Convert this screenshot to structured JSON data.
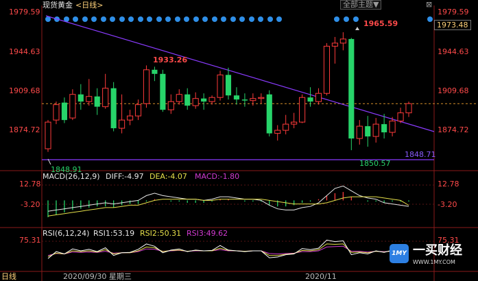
{
  "header": {
    "symbol": "现货黄金",
    "period_selector": "<日线>",
    "all_indicators_button": "全部主题▼",
    "close_button": "⊠"
  },
  "price_axis": {
    "left_ticks": [
      "1979.59",
      "1944.63",
      "1909.68",
      "1874.72"
    ],
    "right_ticks": [
      "1979.59",
      "1944.63",
      "1909.68",
      "1874.72"
    ],
    "current_price": "1973.48"
  },
  "annotations": {
    "high_left": "1933.26",
    "high_right": "1965.59",
    "low_left": "1848.91",
    "low_right": "1850.57",
    "line_price": "1848.71"
  },
  "macd": {
    "title": "MACD(26,12,9)",
    "diff": "DIFF:-4.97",
    "dea": "DEA:-4.07",
    "macd": "MACD:-1.80",
    "ticks_left": [
      "12.78",
      "-3.20"
    ],
    "ticks_right": [
      "12.78",
      "-3.20"
    ]
  },
  "rsi": {
    "title": "RSI(6,12,24)",
    "rsi1": "RSI1:53.19",
    "rsi2": "RSI2:50.31",
    "rsi3": "RSI3:49.62",
    "tick_left": "75.31",
    "tick_right": "75.31"
  },
  "footer": {
    "period": "日线",
    "date": "2020/09/30 星期三",
    "month_label": "2020/11"
  },
  "watermark": {
    "logo_text": "1MY",
    "title": "一买财经",
    "url": "WWW.1MY.COM"
  },
  "colors": {
    "up": "#ff3b3b",
    "down": "#27d46a",
    "trendline": "#8a3bff",
    "macd_diff": "#e8e8e8",
    "macd_dea": "#e6e04a",
    "rsi1": "#ffffff",
    "rsi2": "#e6e04a",
    "rsi3": "#d23bd2",
    "event_dot": "#2f8fe8"
  },
  "chart_data": {
    "type": "candlestick",
    "candles": [
      {
        "o": 1852,
        "h": 1880,
        "c": 1878,
        "l": 1848.91
      },
      {
        "o": 1880,
        "h": 1898,
        "c": 1895,
        "l": 1876
      },
      {
        "o": 1897,
        "h": 1902,
        "c": 1880,
        "l": 1877
      },
      {
        "o": 1882,
        "h": 1910,
        "c": 1905,
        "l": 1880
      },
      {
        "o": 1905,
        "h": 1915,
        "c": 1898,
        "l": 1890
      },
      {
        "o": 1898,
        "h": 1920,
        "c": 1903,
        "l": 1894
      },
      {
        "o": 1903,
        "h": 1911,
        "c": 1893,
        "l": 1885
      },
      {
        "o": 1893,
        "h": 1925,
        "c": 1911,
        "l": 1891
      },
      {
        "o": 1911,
        "h": 1917,
        "c": 1872,
        "l": 1869
      },
      {
        "o": 1872,
        "h": 1905,
        "c": 1880,
        "l": 1867
      },
      {
        "o": 1880,
        "h": 1890,
        "c": 1884,
        "l": 1875
      },
      {
        "o": 1884,
        "h": 1900,
        "c": 1895,
        "l": 1880
      },
      {
        "o": 1896,
        "h": 1933.26,
        "c": 1929,
        "l": 1892
      },
      {
        "o": 1929,
        "h": 1932,
        "c": 1925,
        "l": 1918
      },
      {
        "o": 1925,
        "h": 1929,
        "c": 1890,
        "l": 1888
      },
      {
        "o": 1890,
        "h": 1905,
        "c": 1898,
        "l": 1886
      },
      {
        "o": 1898,
        "h": 1910,
        "c": 1905,
        "l": 1895
      },
      {
        "o": 1905,
        "h": 1911,
        "c": 1894,
        "l": 1890
      },
      {
        "o": 1894,
        "h": 1907,
        "c": 1901,
        "l": 1891
      },
      {
        "o": 1901,
        "h": 1906,
        "c": 1898,
        "l": 1890
      },
      {
        "o": 1898,
        "h": 1904,
        "c": 1902,
        "l": 1895
      },
      {
        "o": 1902,
        "h": 1928,
        "c": 1924,
        "l": 1899
      },
      {
        "o": 1924,
        "h": 1931,
        "c": 1904,
        "l": 1900
      },
      {
        "o": 1904,
        "h": 1912,
        "c": 1900,
        "l": 1895
      },
      {
        "o": 1900,
        "h": 1906,
        "c": 1899,
        "l": 1893
      },
      {
        "o": 1899,
        "h": 1906,
        "c": 1901,
        "l": 1894
      },
      {
        "o": 1901,
        "h": 1906,
        "c": 1902,
        "l": 1896
      },
      {
        "o": 1905,
        "h": 1909,
        "c": 1867,
        "l": 1864
      },
      {
        "o": 1867,
        "h": 1875,
        "c": 1870,
        "l": 1860
      },
      {
        "o": 1870,
        "h": 1885,
        "c": 1876,
        "l": 1866
      },
      {
        "o": 1876,
        "h": 1887,
        "c": 1878,
        "l": 1872
      },
      {
        "o": 1878,
        "h": 1905,
        "c": 1902,
        "l": 1877
      },
      {
        "o": 1902,
        "h": 1912,
        "c": 1898,
        "l": 1893
      },
      {
        "o": 1898,
        "h": 1911,
        "c": 1906,
        "l": 1895
      },
      {
        "o": 1906,
        "h": 1955,
        "c": 1952,
        "l": 1904
      },
      {
        "o": 1952,
        "h": 1961,
        "c": 1955,
        "l": 1935
      },
      {
        "o": 1955,
        "h": 1965.59,
        "c": 1959,
        "l": 1948
      },
      {
        "o": 1959,
        "h": 1960,
        "c": 1862,
        "l": 1850.57
      },
      {
        "o": 1862,
        "h": 1880,
        "c": 1874,
        "l": 1856
      },
      {
        "o": 1874,
        "h": 1884,
        "c": 1864,
        "l": 1854
      },
      {
        "o": 1864,
        "h": 1882,
        "c": 1876,
        "l": 1858
      },
      {
        "o": 1876,
        "h": 1886,
        "c": 1868,
        "l": 1862
      },
      {
        "o": 1868,
        "h": 1883,
        "c": 1879,
        "l": 1864
      },
      {
        "o": 1879,
        "h": 1892,
        "c": 1887,
        "l": 1877
      },
      {
        "o": 1887,
        "h": 1898,
        "c": 1896,
        "l": 1883
      }
    ],
    "ylim": [
      1842,
      1985
    ],
    "macd_hist": [
      -14,
      -12,
      -10,
      -8,
      -7,
      -6,
      -5,
      -5,
      -6,
      -4,
      -3,
      -3,
      -1,
      1,
      0,
      -1,
      -1,
      -2,
      -2,
      -2,
      -1,
      1,
      1,
      0,
      -1,
      -1,
      -1,
      -4,
      -5,
      -5,
      -4,
      -2,
      -1,
      1,
      4,
      6,
      7,
      3,
      0,
      -1,
      -1,
      -2,
      -1,
      -1,
      -1
    ],
    "macd_diff": [
      -9,
      -8,
      -7,
      -6,
      -5,
      -4,
      -3,
      -2,
      -3,
      -2,
      -1,
      0,
      4,
      6,
      4,
      3,
      2,
      1,
      1,
      0,
      1,
      3,
      3,
      2,
      1,
      1,
      0,
      -4,
      -7,
      -8,
      -8,
      -6,
      -5,
      -2,
      4,
      10,
      12,
      8,
      4,
      2,
      1,
      -2,
      -3,
      -4,
      -4.97
    ],
    "macd_dea": [
      -13,
      -12,
      -11,
      -10,
      -9,
      -8,
      -7,
      -6,
      -6,
      -5,
      -4,
      -4,
      -2,
      0,
      1,
      1,
      1,
      1,
      1,
      0,
      0,
      1,
      1,
      1,
      1,
      1,
      1,
      0,
      -1,
      -2,
      -3,
      -3,
      -3,
      -3,
      -2,
      0,
      2,
      3,
      3,
      3,
      3,
      2,
      1,
      0,
      -4.07
    ],
    "rsi1": [
      30,
      48,
      42,
      55,
      50,
      54,
      48,
      58,
      38,
      45,
      46,
      54,
      68,
      62,
      45,
      52,
      55,
      48,
      52,
      50,
      51,
      64,
      52,
      50,
      48,
      50,
      50,
      32,
      34,
      40,
      42,
      56,
      53,
      57,
      78,
      74,
      76,
      40,
      45,
      42,
      50,
      46,
      52,
      54,
      53.19
    ],
    "rsi2": [
      35,
      44,
      42,
      50,
      48,
      50,
      47,
      53,
      42,
      45,
      45,
      50,
      60,
      58,
      48,
      51,
      52,
      49,
      51,
      50,
      50,
      57,
      51,
      50,
      49,
      50,
      50,
      38,
      38,
      41,
      43,
      51,
      50,
      53,
      68,
      67,
      68,
      46,
      47,
      45,
      49,
      47,
      50,
      51,
      50.31
    ],
    "rsi3": [
      38,
      43,
      42,
      47,
      46,
      47,
      46,
      49,
      44,
      45,
      45,
      48,
      55,
      54,
      49,
      50,
      51,
      49,
      50,
      50,
      50,
      53,
      50,
      50,
      49,
      50,
      50,
      43,
      42,
      43,
      44,
      48,
      48,
      50,
      60,
      61,
      62,
      49,
      49,
      47,
      49,
      48,
      49,
      50,
      49.62
    ]
  }
}
